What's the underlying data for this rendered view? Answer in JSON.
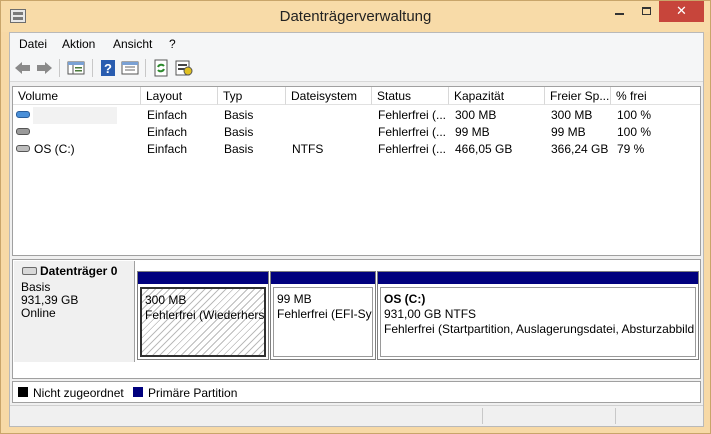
{
  "window": {
    "title": "Datenträgerverwaltung",
    "close_label": "✕"
  },
  "menu": [
    "Datei",
    "Aktion",
    "Ansicht",
    "?"
  ],
  "toolbar": {
    "icons": [
      "back-icon",
      "forward-icon",
      "console-tree-icon",
      "help-icon",
      "properties-icon",
      "refresh-icon",
      "disk-settings-icon"
    ]
  },
  "volume_list": {
    "columns": [
      "Volume",
      "Layout",
      "Typ",
      "Dateisystem",
      "Status",
      "Kapazität",
      "Freier Sp...",
      "% frei"
    ],
    "rows": [
      {
        "volume": "",
        "layout": "Einfach",
        "type": "Basis",
        "fs": "",
        "status": "Fehlerfrei (...",
        "capacity": "300 MB",
        "free": "300 MB",
        "pct": "100 %"
      },
      {
        "volume": "",
        "layout": "Einfach",
        "type": "Basis",
        "fs": "",
        "status": "Fehlerfrei (...",
        "capacity": "99 MB",
        "free": "99 MB",
        "pct": "100 %"
      },
      {
        "volume": "OS (C:)",
        "layout": "Einfach",
        "type": "Basis",
        "fs": "NTFS",
        "status": "Fehlerfrei (...",
        "capacity": "466,05 GB",
        "free": "366,24 GB",
        "pct": "79 %"
      }
    ]
  },
  "disk": {
    "name": "Datenträger 0",
    "type": "Basis",
    "size": "931,39 GB",
    "state": "Online",
    "partitions": [
      {
        "label": "",
        "size": "300 MB",
        "status": "Fehlerfrei (Wiederherstellungspartition)"
      },
      {
        "label": "",
        "size": "99 MB",
        "status": "Fehlerfrei (EFI-Systempartition)"
      },
      {
        "label": "OS  (C:)",
        "size": "931,00 GB NTFS",
        "status": "Fehlerfrei (Startpartition, Auslagerungsdatei, Absturzabbild"
      }
    ]
  },
  "legend": {
    "unallocated": {
      "label": "Nicht zugeordnet",
      "color": "#000000"
    },
    "primary": {
      "label": "Primäre Partition",
      "color": "#00007e"
    }
  },
  "colors": {
    "title_bar": "#f8dba8",
    "close_button": "#c7453b",
    "partition_header": "#00007e"
  }
}
